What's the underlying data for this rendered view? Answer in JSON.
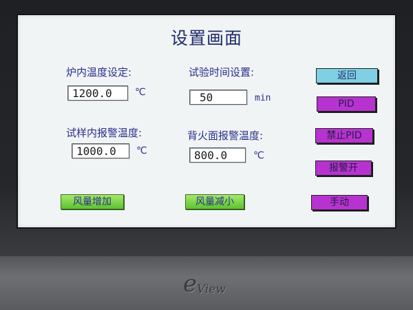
{
  "screen": {
    "title": "设置画面",
    "furnace_temp": {
      "label": "炉内温度设定:",
      "value": "1200.0",
      "unit": "℃"
    },
    "test_time": {
      "label": "试验时间设置:",
      "value": "50",
      "unit": "min"
    },
    "sample_alarm_temp": {
      "label": "试样内报警温度:",
      "value": "1000.0",
      "unit": "℃"
    },
    "backfire_alarm_temp": {
      "label": "背火面报警温度:",
      "value": "800.0",
      "unit": "℃"
    },
    "buttons": {
      "back": "返回",
      "pid": "PID",
      "disable_pid": "禁止PID",
      "alarm_on": "报警开",
      "manual": "手动",
      "fan_increase": "风量增加",
      "fan_decrease": "风量减小"
    },
    "colors": {
      "screen_bg": "#f1f4f5",
      "label_text": "#2a2f8a",
      "back_button": "#7fd0e3",
      "purple_button": "#b832d1",
      "green_button": "#5cc22f"
    }
  },
  "device": {
    "brand_e": "e",
    "brand_view": "View"
  }
}
